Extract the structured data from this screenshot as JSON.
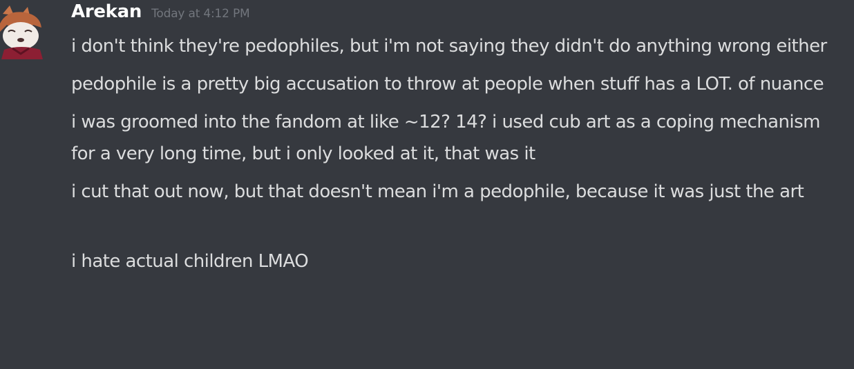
{
  "message": {
    "author": "Arekan",
    "timestamp": "Today at 4:12 PM",
    "lines": [
      "i don't think they're pedophiles, but i'm not saying they didn't do anything wrong either",
      "pedophile is a pretty big accusation to throw at people when stuff has a LOT. of nuance",
      "i was groomed into the fandom at like ~12? 14? i used cub art as a coping mechanism for a very long time, but i only looked at it, that was it",
      "i cut that out now, but that doesn't mean i'm a pedophile, because it was just the art",
      "i hate actual children LMAO"
    ]
  },
  "colors": {
    "background": "#36393f",
    "username": "#ffffff",
    "timestamp": "#72767d",
    "text": "#dcddde"
  }
}
